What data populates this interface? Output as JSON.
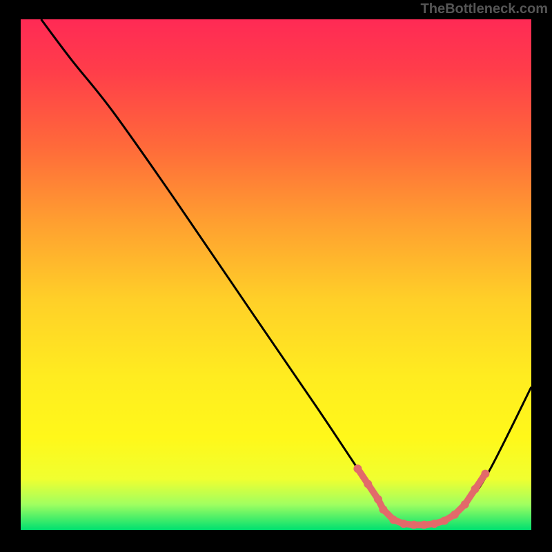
{
  "watermark": "TheBottleneck.com",
  "chart_data": {
    "type": "line",
    "title": "",
    "xlabel": "",
    "ylabel": "",
    "xlim": [
      0,
      100
    ],
    "ylim": [
      0,
      100
    ],
    "gradient_stops": [
      {
        "offset": 0.0,
        "color": "#ff2a55"
      },
      {
        "offset": 0.1,
        "color": "#ff3d4a"
      },
      {
        "offset": 0.25,
        "color": "#ff6a3a"
      },
      {
        "offset": 0.4,
        "color": "#ffa030"
      },
      {
        "offset": 0.55,
        "color": "#ffd028"
      },
      {
        "offset": 0.7,
        "color": "#ffec20"
      },
      {
        "offset": 0.82,
        "color": "#fff81a"
      },
      {
        "offset": 0.9,
        "color": "#f0ff30"
      },
      {
        "offset": 0.95,
        "color": "#a0ff60"
      },
      {
        "offset": 1.0,
        "color": "#00e070"
      }
    ],
    "series": [
      {
        "name": "curve",
        "stroke": "#000000",
        "x": [
          4,
          10,
          18,
          30,
          45,
          58,
          66,
          70,
          73,
          76,
          80,
          84,
          88,
          92,
          100
        ],
        "y": [
          100,
          92,
          82,
          65,
          43,
          24,
          12,
          6,
          2,
          1,
          1,
          2,
          6,
          12,
          28
        ]
      }
    ],
    "markers": {
      "name": "trough-markers",
      "color": "#e26a6a",
      "radius": 6,
      "x": [
        66,
        68,
        70,
        71,
        73,
        75,
        77,
        79,
        81,
        83,
        85,
        87,
        89,
        91
      ],
      "y": [
        12,
        9,
        6,
        4,
        2,
        1.2,
        1,
        1,
        1.2,
        1.8,
        3,
        5,
        8,
        11
      ]
    }
  }
}
